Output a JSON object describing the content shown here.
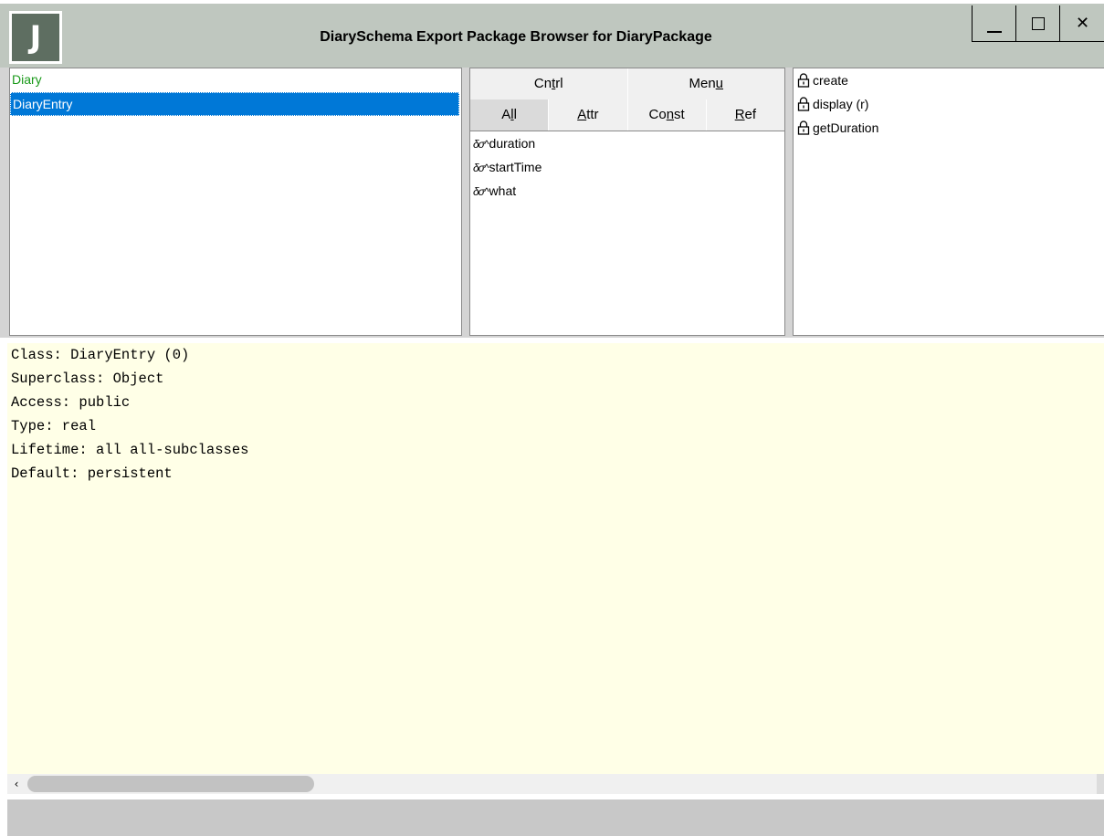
{
  "window": {
    "title": "DiarySchema Export Package Browser for DiaryPackage",
    "app_icon_letter": "J"
  },
  "classes": [
    {
      "label": "Diary",
      "color": "#1a9a1a",
      "selected": false
    },
    {
      "label": "DiaryEntry",
      "selected": true
    }
  ],
  "tabs": {
    "top": [
      {
        "label": "Cntrl",
        "underline_index": 2
      },
      {
        "label": "Menu",
        "underline_index": 3
      }
    ],
    "bottom": [
      {
        "label": "All",
        "underline_index": 1,
        "active": true
      },
      {
        "label": "Attr",
        "underline_index": 0
      },
      {
        "label": "Const",
        "underline_index": 2
      },
      {
        "label": "Ref",
        "underline_index": 0
      }
    ]
  },
  "features": [
    {
      "icon": "glasses-icon",
      "glyph": "δσ^",
      "label": "duration"
    },
    {
      "icon": "glasses-icon",
      "glyph": "δσ^",
      "label": "startTime"
    },
    {
      "icon": "glasses-icon",
      "glyph": "δσ^",
      "label": "what"
    }
  ],
  "methods": [
    {
      "icon": "lock-icon",
      "label": "create"
    },
    {
      "icon": "lock-icon",
      "label": "display (r)"
    },
    {
      "icon": "lock-icon",
      "label": "getDuration"
    }
  ],
  "info": [
    "Class: DiaryEntry (0)",
    "Superclass: Object",
    "Access: public",
    "Type: real",
    "Lifetime: all all-subclasses",
    "Default: persistent"
  ],
  "scrollbar": {
    "left_arrow": "‹"
  },
  "colors": {
    "selection": "#0078d7",
    "info_background": "#ffffe7",
    "titlebar": "#bfc7bf"
  }
}
